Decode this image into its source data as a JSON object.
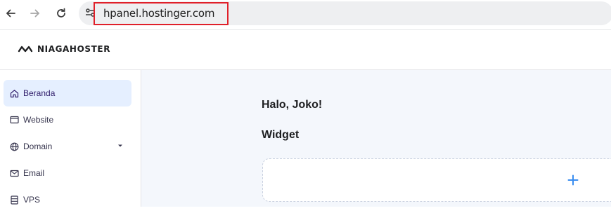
{
  "browser": {
    "url": "hpanel.hostinger.com",
    "back_icon": "arrow-left-icon",
    "forward_icon": "arrow-right-icon",
    "reload_icon": "reload-icon",
    "site_info_icon": "tune-icon"
  },
  "header": {
    "logo_text": "NIAGAHOSTER",
    "logo_icon": "infinity-logo-icon"
  },
  "sidebar": {
    "items": [
      {
        "label": "Beranda",
        "icon": "home-icon",
        "active": true
      },
      {
        "label": "Website",
        "icon": "browser-window-icon"
      },
      {
        "label": "Domain",
        "icon": "globe-icon",
        "has_dropdown": true
      },
      {
        "label": "Email",
        "icon": "mail-icon"
      },
      {
        "label": "VPS",
        "icon": "server-icon"
      }
    ]
  },
  "main": {
    "greeting": "Halo, Joko!",
    "widget_title": "Widget",
    "add_icon": "plus-icon"
  },
  "colors": {
    "accent": "#673de6",
    "active_bg": "#e5efff",
    "plus_blue": "#3b8ef0",
    "highlight_red": "#e0202a",
    "main_bg": "#f4f7fc"
  }
}
